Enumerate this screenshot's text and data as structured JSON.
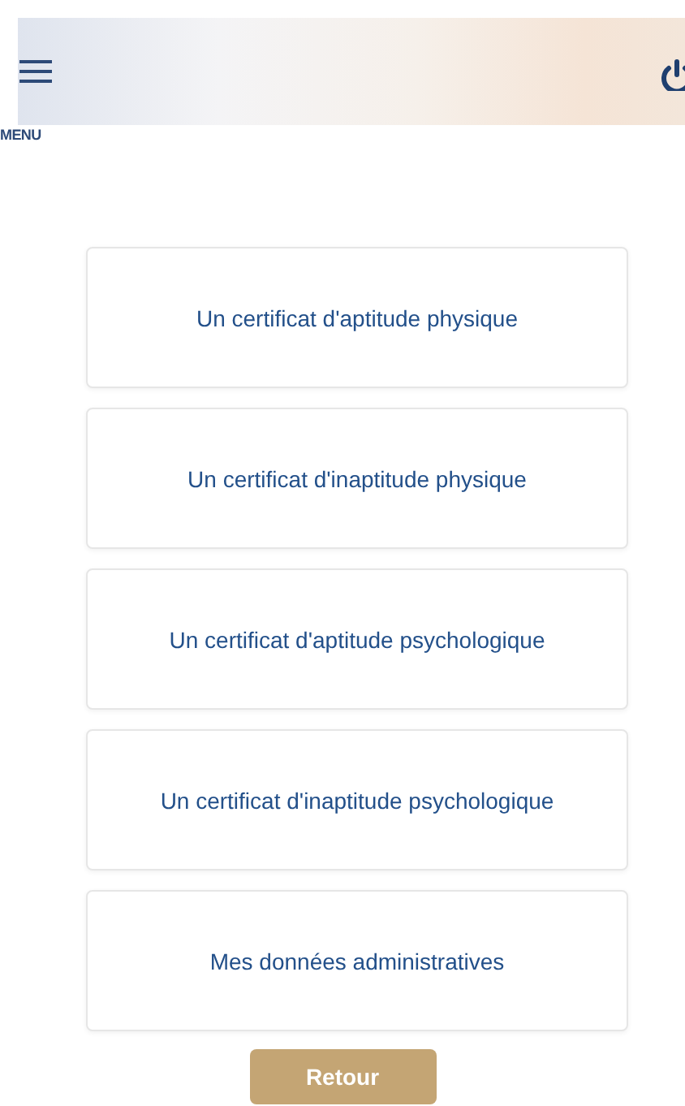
{
  "header": {
    "menu_label": "MENU"
  },
  "options": [
    {
      "label": "Un certificat d'aptitude physique"
    },
    {
      "label": "Un certificat d'inaptitude physique"
    },
    {
      "label": "Un certificat d'aptitude psychologique"
    },
    {
      "label": "Un certificat d'inaptitude psychologique"
    },
    {
      "label": "Mes données administratives"
    }
  ],
  "back_button": {
    "label": "Retour"
  }
}
